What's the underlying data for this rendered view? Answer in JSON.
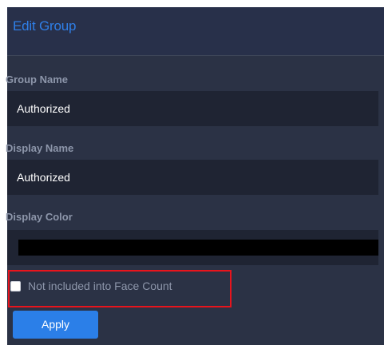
{
  "header": {
    "title": "Edit Group"
  },
  "fields": {
    "group_name": {
      "label": "Group Name",
      "value": "Authorized"
    },
    "display_name": {
      "label": "Display Name",
      "value": "Authorized"
    },
    "display_color": {
      "label": "Display Color",
      "value": "#000000"
    }
  },
  "face_count_option": {
    "label": "Not included into Face Count",
    "checked": false
  },
  "actions": {
    "apply_label": "Apply"
  },
  "colors": {
    "accent": "#2b7fe8",
    "highlight": "#e8141c",
    "panel": "#2b3245",
    "field": "#1f2433"
  }
}
